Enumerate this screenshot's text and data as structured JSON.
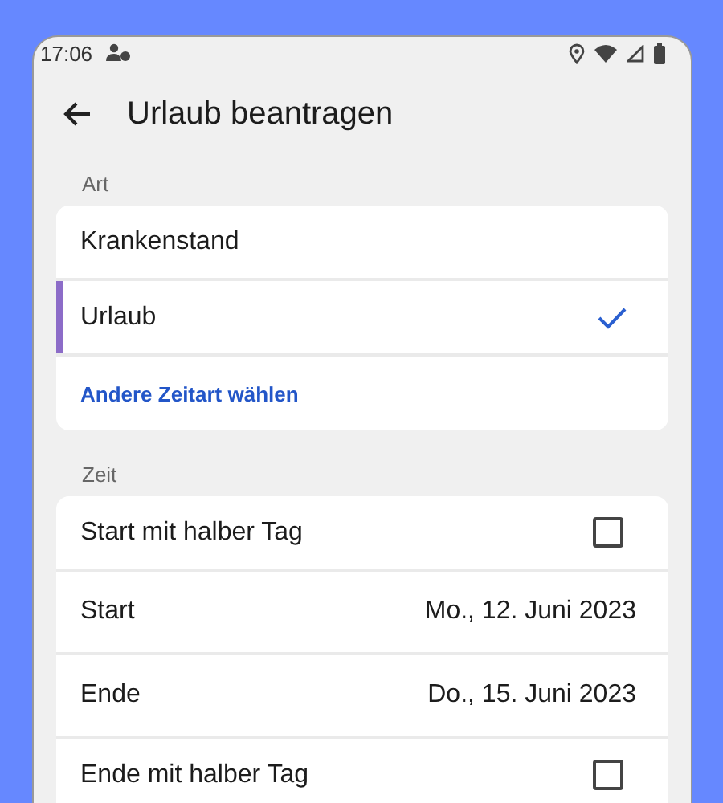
{
  "status_bar": {
    "time": "17:06"
  },
  "app_bar": {
    "title": "Urlaub beantragen"
  },
  "art": {
    "heading": "Art",
    "items": [
      {
        "label": "Krankenstand",
        "selected": false
      },
      {
        "label": "Urlaub",
        "selected": true
      }
    ],
    "link": "Andere Zeitart wählen"
  },
  "zeit": {
    "heading": "Zeit",
    "rows": [
      {
        "kind": "checkbox",
        "label": "Start mit halber Tag",
        "checked": false
      },
      {
        "kind": "date",
        "label": "Start",
        "value": "Mo., 12. Juni 2023"
      },
      {
        "kind": "date",
        "label": "Ende",
        "value": "Do., 15. Juni 2023"
      },
      {
        "kind": "checkbox",
        "label": "Ende mit halber Tag",
        "checked": false
      }
    ]
  }
}
